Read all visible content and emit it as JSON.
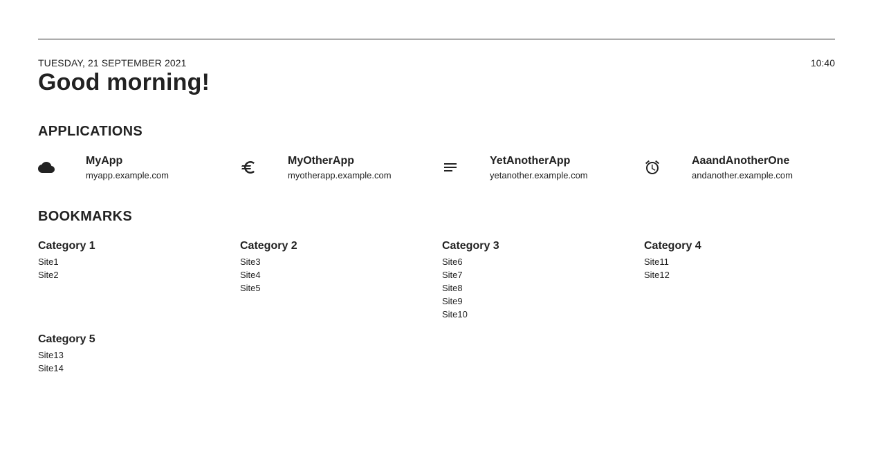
{
  "header": {
    "date": "TUESDAY, 21 SEPTEMBER 2021",
    "time": "10:40",
    "greeting": "Good morning!"
  },
  "applications": {
    "title": "APPLICATIONS",
    "items": [
      {
        "name": "MyApp",
        "url": "myapp.example.com",
        "icon": "cloud-icon"
      },
      {
        "name": "MyOtherApp",
        "url": "myotherapp.example.com",
        "icon": "euro-icon"
      },
      {
        "name": "YetAnotherApp",
        "url": "yetanother.example.com",
        "icon": "notes-icon"
      },
      {
        "name": "AaandAnotherOne",
        "url": "andanother.example.com",
        "icon": "alarm-clock-icon"
      }
    ]
  },
  "bookmarks": {
    "title": "BOOKMARKS",
    "categories": [
      {
        "name": "Category 1",
        "links": [
          "Site1",
          "Site2"
        ]
      },
      {
        "name": "Category 2",
        "links": [
          "Site3",
          "Site4",
          "Site5"
        ]
      },
      {
        "name": "Category 3",
        "links": [
          "Site6",
          "Site7",
          "Site8",
          "Site9",
          "Site10"
        ]
      },
      {
        "name": "Category 4",
        "links": [
          "Site11",
          "Site12"
        ]
      },
      {
        "name": "Category 5",
        "links": [
          "Site13",
          "Site14"
        ]
      }
    ]
  },
  "colors": {
    "text": "#222222",
    "background": "#ffffff"
  }
}
